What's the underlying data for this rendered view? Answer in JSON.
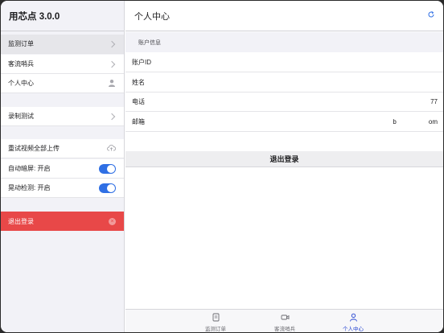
{
  "app": {
    "title": "用芯点 3.0.0"
  },
  "sidebar": {
    "items": [
      {
        "label": "监测订单",
        "icon": "chevron-right-icon"
      },
      {
        "label": "客流哨兵",
        "icon": "chevron-right-icon"
      },
      {
        "label": "个人中心",
        "icon": "person-icon"
      },
      {
        "label": "录制测试",
        "icon": "chevron-right-icon"
      },
      {
        "label": "重试视频全部上传",
        "icon": "cloud-upload-icon"
      },
      {
        "label": "自动暗屏: 开启",
        "toggle_on": true
      },
      {
        "label": "晃动检测: 开启",
        "toggle_on": true
      }
    ],
    "logout": {
      "label": "退出登录",
      "icon": "close-circle-icon"
    }
  },
  "main": {
    "title": "个人中心",
    "refresh_icon": "refresh-icon",
    "section_label": "账户信息",
    "rows": [
      {
        "label": "账户ID",
        "value": ""
      },
      {
        "label": "姓名",
        "value": ""
      },
      {
        "label": "电话",
        "value": "77"
      },
      {
        "label": "邮箱",
        "value": "b                  om"
      }
    ],
    "logout_button": "退出登录"
  },
  "tabbar": {
    "tabs": [
      {
        "label": "监测订单",
        "icon": "document-icon",
        "active": false
      },
      {
        "label": "客流哨兵",
        "icon": "video-camera-icon",
        "active": false
      },
      {
        "label": "个人中心",
        "icon": "person-icon",
        "active": true
      }
    ]
  },
  "colors": {
    "accent": "#2f6fe4",
    "logout": "#e84848",
    "tab_active": "#1f3fd0"
  }
}
